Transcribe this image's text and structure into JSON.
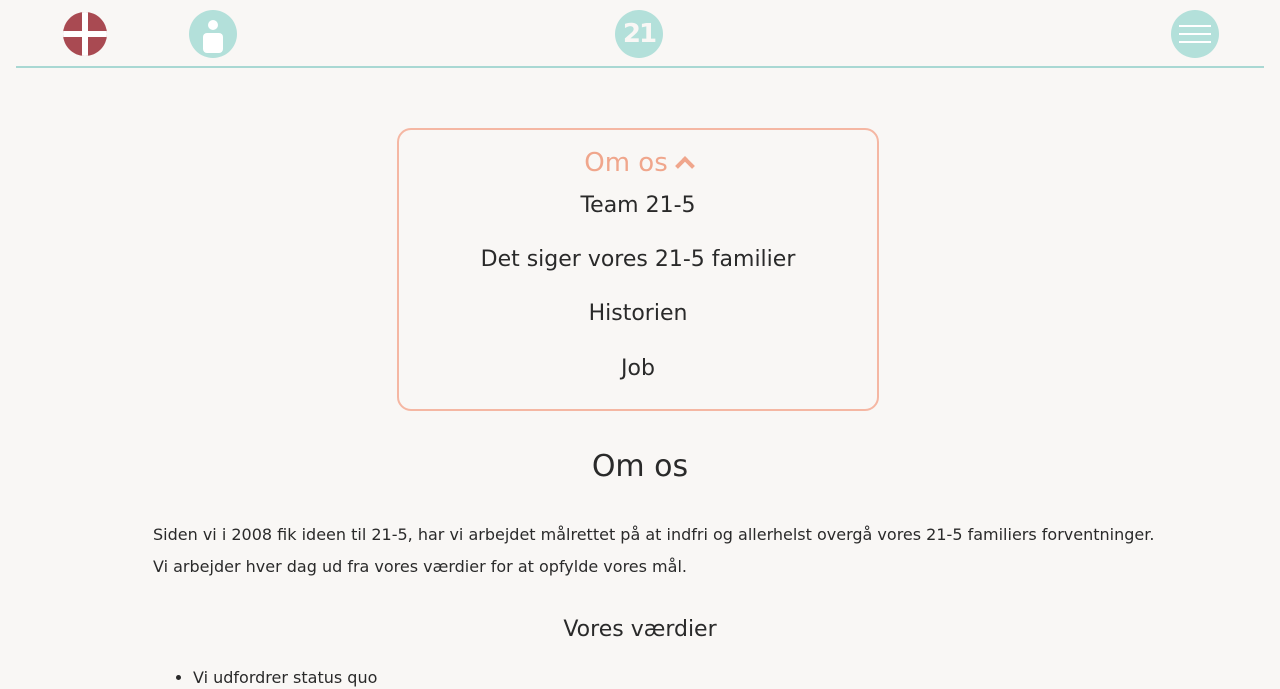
{
  "header": {
    "language_icon": "denmark-flag-icon",
    "user_icon": "user-icon",
    "logo_text": "21",
    "menu_icon": "hamburger-menu-icon"
  },
  "submenu": {
    "title": "Om os",
    "items": [
      {
        "label": "Team 21-5"
      },
      {
        "label": "Det siger vores 21-5 familier"
      },
      {
        "label": "Historien"
      },
      {
        "label": "Job"
      }
    ]
  },
  "main": {
    "title": "Om os",
    "paragraphs": [
      "Siden vi i 2008 fik ideen til 21-5, har vi arbejdet målrettet på at indfri og allerhelst overgå vores 21-5 familiers forventninger.",
      "Vi arbejder hver dag ud fra vores værdier for at opfylde vores mål."
    ],
    "values_heading": "Vores værdier",
    "values": [
      "Vi udfordrer status quo"
    ]
  },
  "colors": {
    "accent_teal": "#b3e0da",
    "accent_salmon": "#f0a68c",
    "flag_red": "#a94a52",
    "background": "#f9f7f5"
  }
}
